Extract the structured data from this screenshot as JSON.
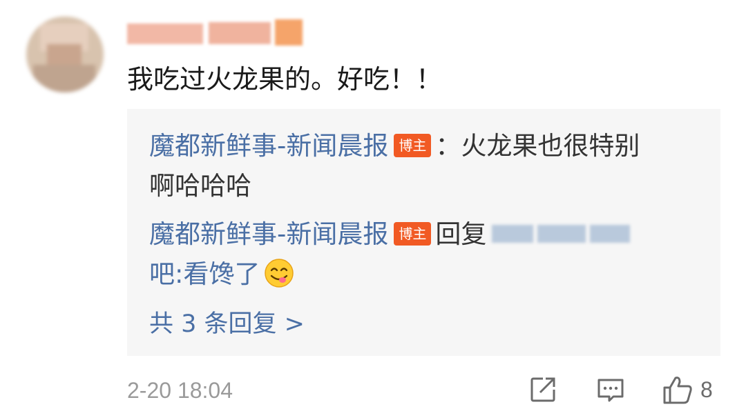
{
  "comment": {
    "text": "我吃过火龙果的。好吃！！",
    "timestamp": "2-20 18:04",
    "like_count": "8"
  },
  "replies": [
    {
      "author": "魔都新鲜事-新闻晨报",
      "badge": "博主",
      "line1_text": "：火龙果也很特别",
      "line2_text": "啊哈哈哈"
    },
    {
      "author": "魔都新鲜事-新闻晨报",
      "badge": "博主",
      "reply_word": "回复",
      "line2_text": "吧:看馋了"
    }
  ],
  "more_replies": "共 3 条回复 >",
  "icons": {
    "share": "share-icon",
    "comment": "comment-icon",
    "like": "thumbs-up-icon",
    "emoji": "yum-emoji"
  },
  "colors": {
    "author_link": "#4a6fa5",
    "badge": "#f15a24",
    "reply_box_bg": "#f6f6f6",
    "meta_gray": "#9a9a9a"
  }
}
